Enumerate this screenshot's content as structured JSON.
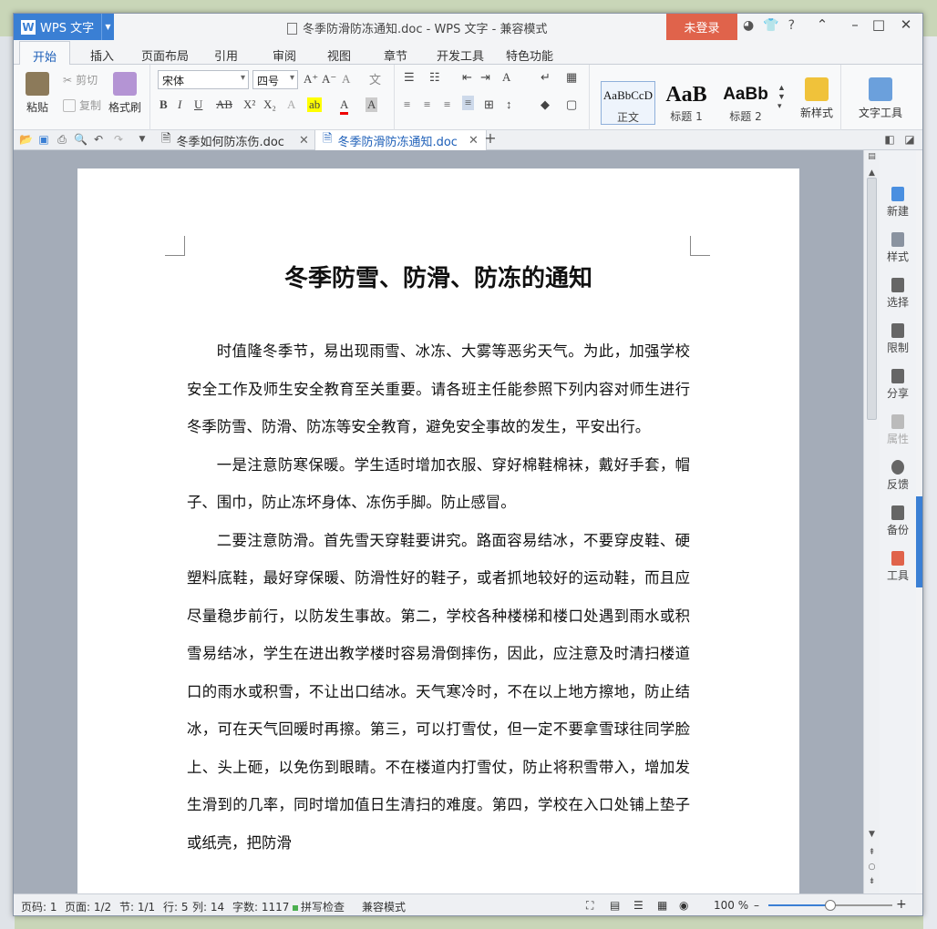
{
  "window": {
    "app_button": "WPS 文字",
    "title": "冬季防滑防冻通知.doc - WPS 文字 - 兼容模式",
    "login_label": "未登录",
    "help_label": "?"
  },
  "ribbon_tabs": [
    "开始",
    "插入",
    "页面布局",
    "引用",
    "审阅",
    "视图",
    "章节",
    "开发工具",
    "特色功能"
  ],
  "ribbon": {
    "paste": "粘贴",
    "cut": "剪切",
    "copy": "复制",
    "format_painter": "格式刷",
    "font_name": "宋体",
    "font_size": "四号",
    "styles": [
      {
        "sample": "AaBbCcD",
        "label": "正文"
      },
      {
        "sample": "AaB",
        "label": "标题 1"
      },
      {
        "sample": "AaBb",
        "label": "标题 2"
      }
    ],
    "new_style": "新样式",
    "text_tools": "文字工具"
  },
  "doc_tabs": [
    {
      "name": "冬季如何防冻伤.doc",
      "active": false
    },
    {
      "name": "冬季防滑防冻通知.doc",
      "active": true
    }
  ],
  "document": {
    "title": "冬季防雪、防滑、防冻的通知",
    "paragraphs": [
      "时值隆冬季节，易出现雨雪、冰冻、大雾等恶劣天气。为此，加强学校安全工作及师生安全教育至关重要。请各班主任能参照下列内容对师生进行冬季防雪、防滑、防冻等安全教育，避免安全事故的发生，平安出行。",
      "一是注意防寒保暖。学生适时增加衣服、穿好棉鞋棉袜，戴好手套，帽子、围巾，防止冻坏身体、冻伤手脚。防止感冒。",
      "二要注意防滑。首先雪天穿鞋要讲究。路面容易结冰，不要穿皮鞋、硬塑料底鞋，最好穿保暖、防滑性好的鞋子，或者抓地较好的运动鞋，而且应尽量稳步前行，以防发生事故。第二，学校各种楼梯和楼口处遇到雨水或积雪易结冰，学生在进出教学楼时容易滑倒摔伤，因此，应注意及时清扫楼道口的雨水或积雪，不让出口结冰。天气寒冷时，不在以上地方擦地，防止结冰，可在天气回暖时再擦。第三，可以打雪仗，但一定不要拿雪球往同学脸上、头上砸，以免伤到眼睛。不在楼道内打雪仗，防止将积雪带入，增加发生滑到的几率，同时增加值日生清扫的难度。第四，学校在入口处铺上垫子或纸壳，把防滑"
    ]
  },
  "side_pane": [
    "新建",
    "样式",
    "选择",
    "限制",
    "分享",
    "属性",
    "反馈",
    "备份",
    "工具"
  ],
  "status": {
    "page_num": "页码: 1",
    "pages": "页面: 1/2",
    "section": "节: 1/1",
    "row": "行: 5",
    "col": "列: 14",
    "word_count": "字数: 1117",
    "spell": "拼写检查",
    "compat": "兼容模式",
    "zoom": "100 %",
    "zoom_fraction": 0.5
  },
  "colors": {
    "accent": "#3a7fd4",
    "login": "#e0634b"
  }
}
